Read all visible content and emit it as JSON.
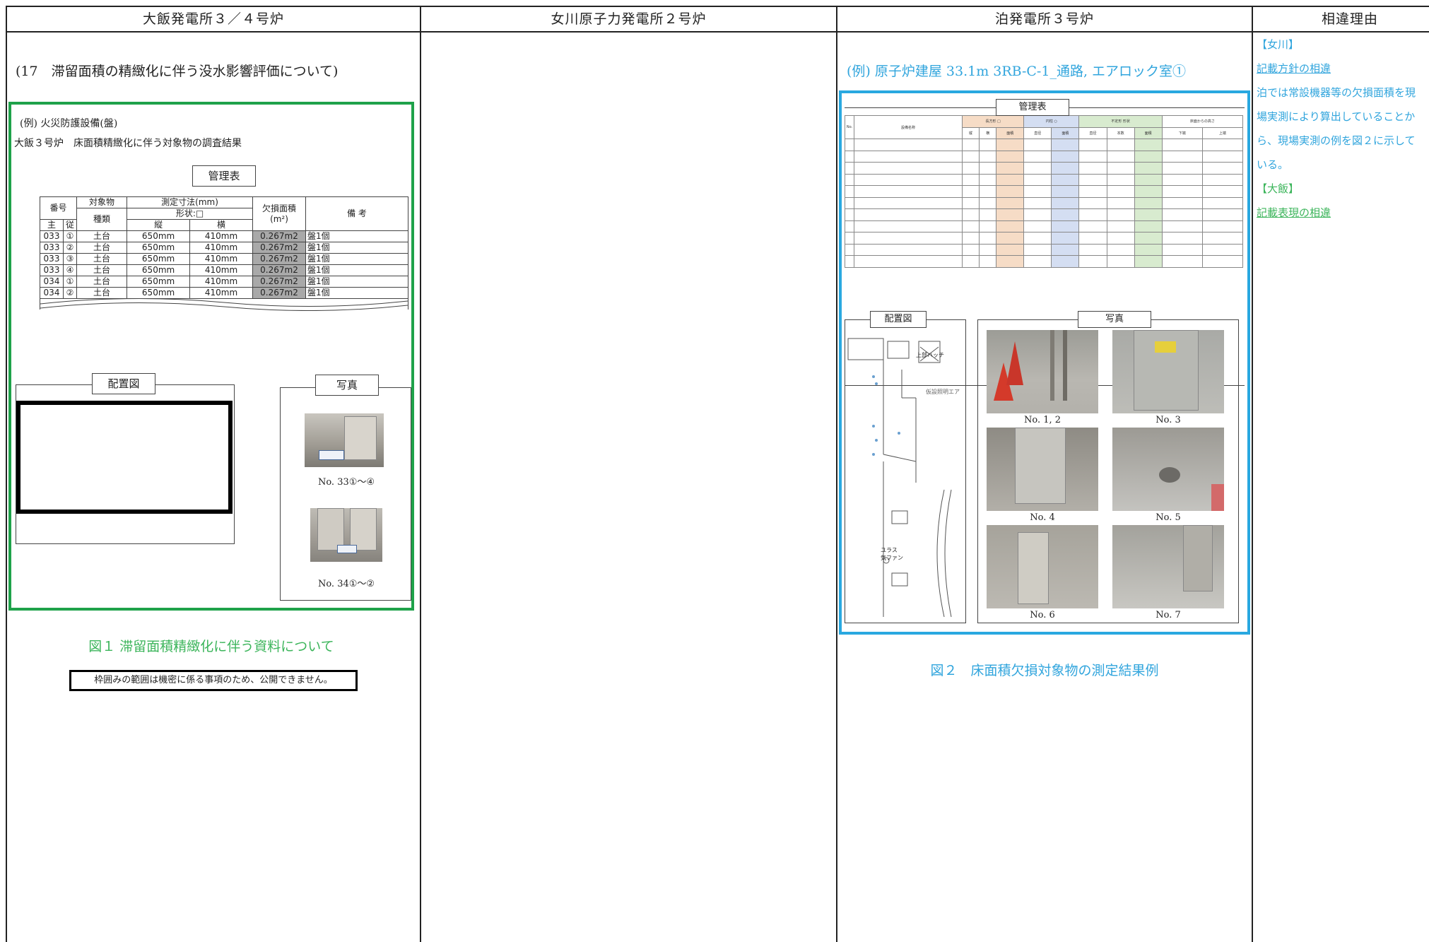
{
  "headers": [
    "大飯発電所３／４号炉",
    "女川原子力発電所２号炉",
    "泊発電所３号炉",
    "相違理由"
  ],
  "ohi": {
    "section_title": "(17　滞留面積の精緻化に伴う没水影響評価について)",
    "example_label": "(例) 火災防護設備(盤)",
    "survey_title": "大飯３号炉　床面積精緻化に伴う対象物の調査結果",
    "table_tab": "管理表",
    "table_head": {
      "number": "番号",
      "main": "主",
      "sub": "従",
      "object": "対象物",
      "kind": "種類",
      "measure": "測定寸法(mm)",
      "shape": "形状:□",
      "vertical": "縦",
      "horizontal": "横",
      "loss_area": "欠損面積",
      "unit": "(m²)",
      "remarks": "備 考"
    },
    "rows": [
      {
        "main": "033",
        "sub": "①",
        "kind": "土台",
        "v": "650mm",
        "h": "410mm",
        "area": "0.267m2",
        "remark": "盤1個"
      },
      {
        "main": "033",
        "sub": "②",
        "kind": "土台",
        "v": "650mm",
        "h": "410mm",
        "area": "0.267m2",
        "remark": "盤1個"
      },
      {
        "main": "033",
        "sub": "③",
        "kind": "土台",
        "v": "650mm",
        "h": "410mm",
        "area": "0.267m2",
        "remark": "盤1個"
      },
      {
        "main": "033",
        "sub": "④",
        "kind": "土台",
        "v": "650mm",
        "h": "410mm",
        "area": "0.267m2",
        "remark": "盤1個"
      },
      {
        "main": "034",
        "sub": "①",
        "kind": "土台",
        "v": "650mm",
        "h": "410mm",
        "area": "0.267m2",
        "remark": "盤1個"
      },
      {
        "main": "034",
        "sub": "②",
        "kind": "土台",
        "v": "650mm",
        "h": "410mm",
        "area": "0.267m2",
        "remark": "盤1個"
      }
    ],
    "layout_tab": "配置図",
    "photo_tab": "写真",
    "photo_captions": [
      "No. 33①～④",
      "No. 34①～②"
    ],
    "figure_caption": "図１ 滞留面積精緻化に伴う資料について",
    "notice": "枠囲みの範囲は機密に係る事項のため、公開できません。"
  },
  "tomari": {
    "section_title": "(例) 原子炉建屋 33.1m 3RB-C-1_通路, エアロック室①",
    "table_tab": "管理表",
    "layout_tab": "配置図",
    "photo_tab": "写真",
    "photo_captions": [
      "No. 1, 2",
      "No. 3",
      "No. 4",
      "No. 5",
      "No. 6",
      "No. 7"
    ],
    "figure_caption": "図２　床面積欠損対象物の測定結果例",
    "map_labels": [
      "上部ハッチ",
      "仮設照明エア",
      "ユラス\n気ファン"
    ]
  },
  "reasons": {
    "onagawa_tag": "【女川】",
    "onagawa_heading": "記載方針の相違",
    "onagawa_body": [
      "泊では常設機器等の欠損面積を現",
      "場実測により算出していることか",
      "ら、現場実測の例を図２に示して",
      "いる。"
    ],
    "ohi_tag": "【大飯】",
    "ohi_heading": "記載表現の相違"
  },
  "colors": {
    "green": "#3cb55b",
    "blue": "#31a5dd",
    "border": "#222222"
  }
}
